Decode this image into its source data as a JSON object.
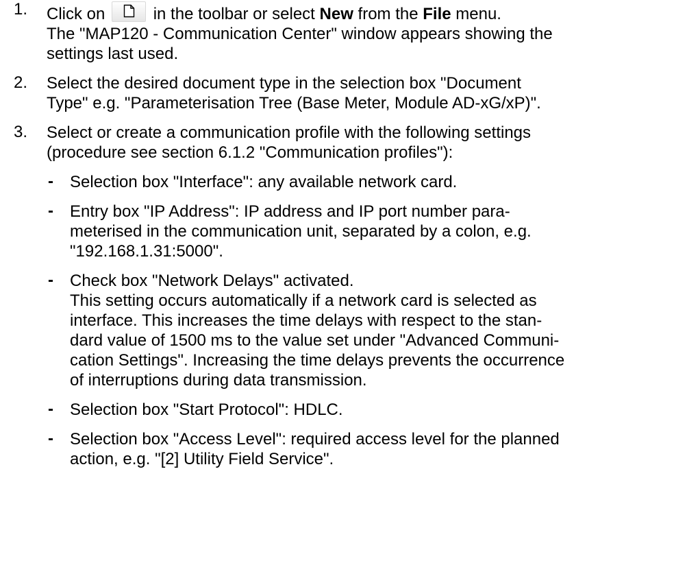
{
  "steps": [
    {
      "number": "1",
      "line1_pre": "Click on",
      "icon": "new-document-icon",
      "line1_mid": "in the toolbar or select",
      "bold_new": "New",
      "line1_from": "from the",
      "bold_file": "File",
      "line1_post": "menu.",
      "line2": "The \"MAP120 - Communication Center\" window appears showing the",
      "line3": "settings last used."
    },
    {
      "number": "2",
      "lines": [
        "Select the desired document type in the selection box \"Document",
        "Type\" e.g. \"Parameterisation Tree (Base Meter, Module AD-xG/xP)\"."
      ]
    },
    {
      "number": "3",
      "lines": [
        "Select or create a communication profile with the following settings",
        "(procedure see section 6.1.2 \"Communication profiles\"):"
      ],
      "bullets": [
        {
          "dash": "-",
          "lines": [
            "Selection box \"Interface\": any available network card."
          ]
        },
        {
          "dash": "-",
          "lines": [
            "Entry box \"IP Address\": IP address and IP port number para-",
            "meterised in the communication unit, separated by a colon, e.g.",
            "\"192.168.1.31:5000\"."
          ]
        },
        {
          "dash": "-",
          "lines": [
            "Check box \"Network Delays\" activated.",
            "This setting occurs automatically if a network card is selected as",
            "interface. This increases the time delays with respect to the stan-",
            "dard value of 1500 ms to the value set under \"Advanced Communi-",
            "cation Settings\". Increasing the time delays prevents the occurrence",
            "of interruptions during data transmission."
          ]
        },
        {
          "dash": "-",
          "lines": [
            "Selection box \"Start Protocol\": HDLC."
          ]
        },
        {
          "dash": "-",
          "lines": [
            "Selection box \"Access Level\": required access level for the planned",
            "action, e.g. \"[2] Utility Field Service\"."
          ]
        }
      ]
    }
  ]
}
